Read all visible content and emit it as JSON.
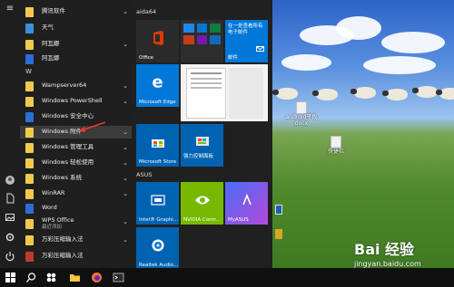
{
  "start_menu": {
    "app_list": {
      "top_items": [
        {
          "label": "腾讯软件",
          "has_chevron": true
        },
        {
          "label": "天气",
          "has_chevron": false
        },
        {
          "label": "阿瓦娜",
          "has_chevron": true
        },
        {
          "label": "阿瓦娜",
          "has_chevron": false
        }
      ],
      "letter_w": "W",
      "w_items": [
        {
          "label": "Wampserver64",
          "has_chevron": true
        },
        {
          "label": "Windows PowerShell",
          "has_chevron": true
        },
        {
          "label": "Windows 安全中心",
          "has_chevron": false
        },
        {
          "label": "Windows 附件",
          "has_chevron": true
        },
        {
          "label": "Windows 管理工具",
          "has_chevron": true
        },
        {
          "label": "Windows 轻松使用",
          "has_chevron": true
        },
        {
          "label": "Windows 系统",
          "has_chevron": true
        },
        {
          "label": "WinRAR",
          "has_chevron": true
        },
        {
          "label": "Word",
          "has_chevron": false
        },
        {
          "label": "WPS Office",
          "sub": "最近添加",
          "has_chevron": true
        },
        {
          "label": "万彩压缩输入法",
          "has_chevron": true
        },
        {
          "label": "万彩压缩输入法",
          "has_chevron": false
        }
      ]
    },
    "tiles": {
      "group1": "aida64",
      "office_label": "Office",
      "mail_label": "在一处查看所有电子邮件",
      "mail_name": "邮件",
      "edge_label": "Microsoft Edge",
      "store_label": "Microsoft Store",
      "control_label": "强力控制面板",
      "group2": "ASUS",
      "intel_label": "Intel® Graphi...",
      "nvidia_label": "NVIDIA Contr...",
      "myasus_label": "MyASUS",
      "realtek_label": "Realtek Audio..."
    }
  },
  "desktop": {
    "file1": "android平板docx",
    "file2": "快捷栏",
    "watermark_brand": "Bai 经验",
    "watermark_site": "jingyan.baidu.com"
  },
  "icons": [
    "windows-start-icon",
    "search-icon",
    "task-view-icon",
    "folder-icon",
    "firefox-icon",
    "terminal-icon",
    "user-icon",
    "document-icon",
    "pictures-icon",
    "settings-icon",
    "power-icon"
  ]
}
